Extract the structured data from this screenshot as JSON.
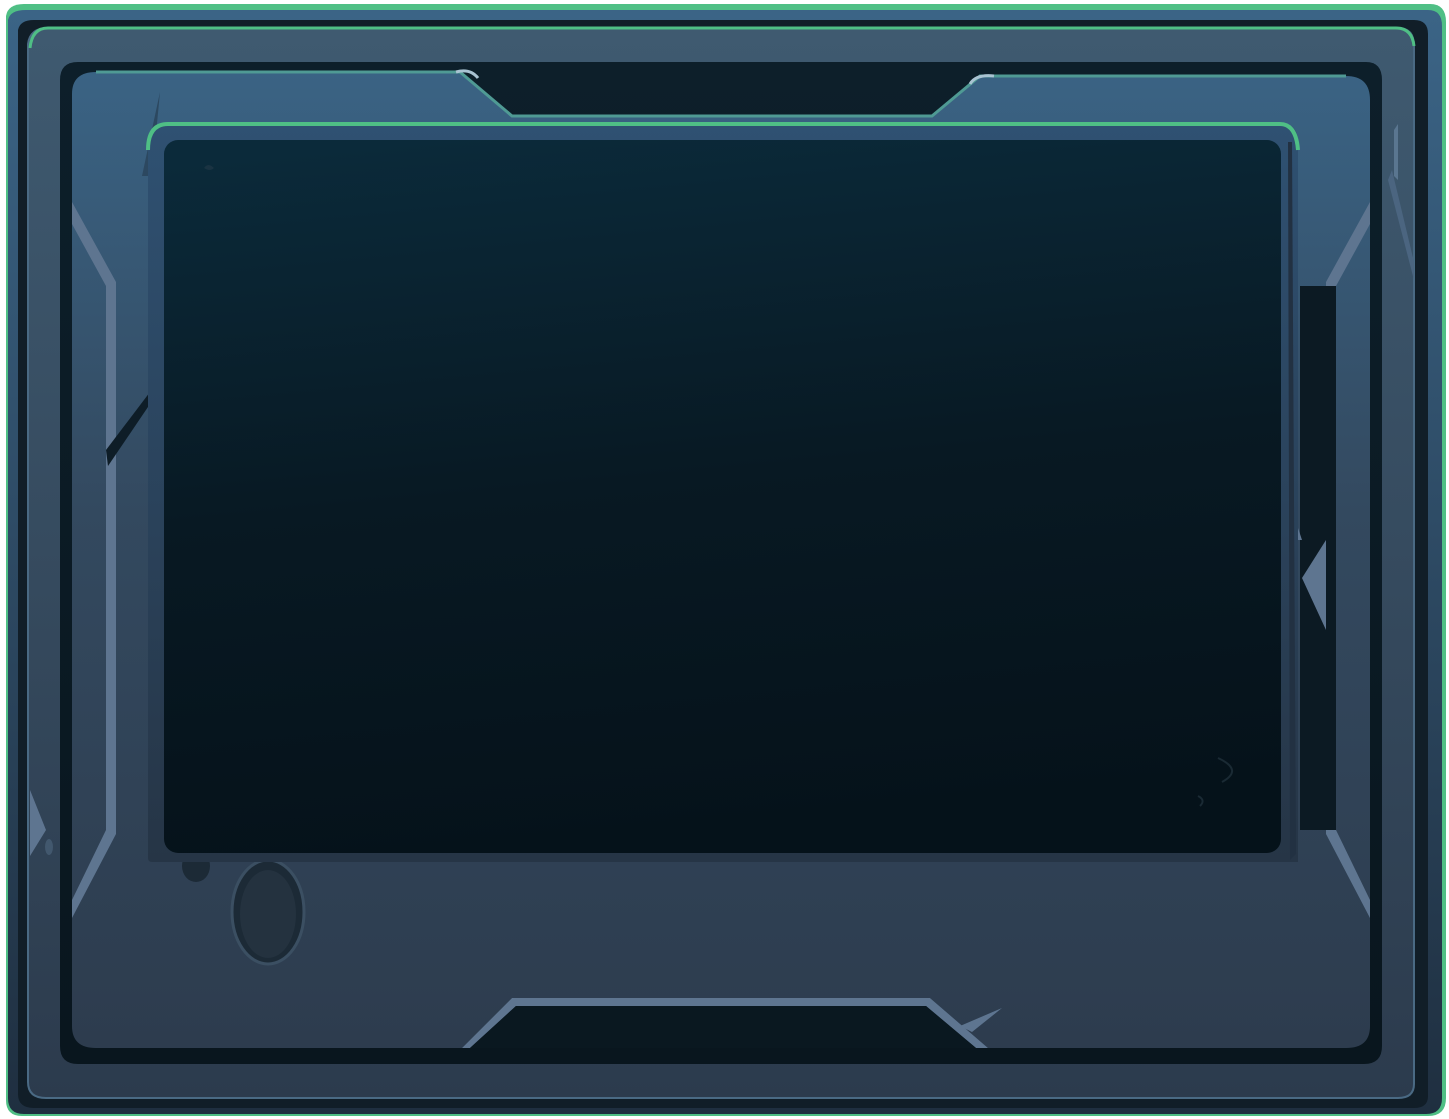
{
  "ui": {
    "kind": "game-panel-frame",
    "text_visible": false
  },
  "palette": {
    "outer_rim_green": "#4fbf85",
    "outer_shell_top": "#3b6486",
    "outer_shell_bottom": "#1f2f40",
    "shell_face_top": "#3f5a70",
    "shell_face_bottom": "#2c3b4d",
    "inner_recess": "#0a1a22",
    "bezel_top": "#3a6384",
    "bezel_bottom": "#2e3d4f",
    "screen_top": "#0b2838",
    "screen_bottom": "#05121a",
    "accent_slate": "#5e7590",
    "highlight": "#a9c3d2"
  },
  "icons": {
    "screen": "display-screen",
    "porthole": "porthole-vent",
    "notch_top": "top-notch",
    "notch_bottom": "bottom-notch"
  }
}
